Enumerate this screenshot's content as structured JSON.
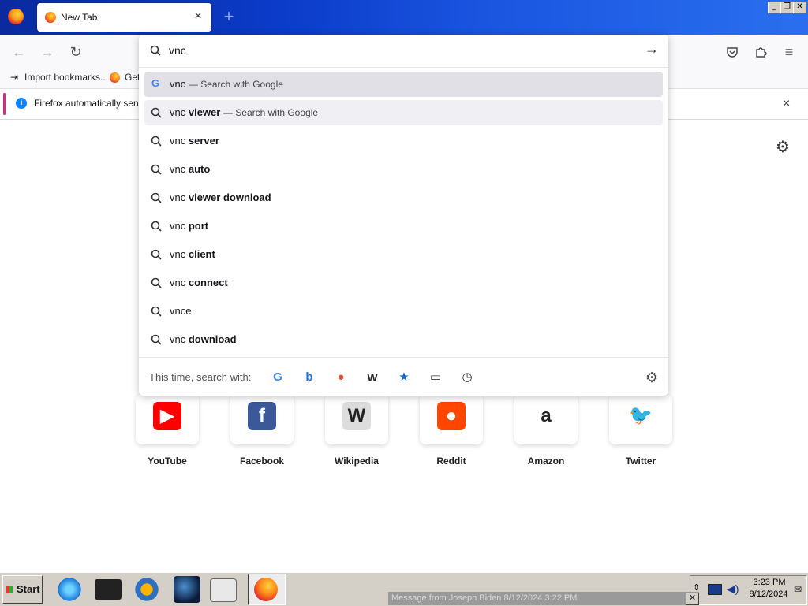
{
  "tab": {
    "title": "New Tab"
  },
  "urlbar": {
    "value": "vnc"
  },
  "bookmarks": [
    {
      "label": "Import bookmarks..."
    },
    {
      "label": "Get"
    }
  ],
  "notification": {
    "text": "Firefox automatically sends"
  },
  "suggestions": [
    {
      "prefix": "vnc",
      "bold": "",
      "suffix": "— Search with Google",
      "icon": "google-icon",
      "state": "selected"
    },
    {
      "prefix": "vnc",
      "bold": "viewer",
      "suffix": "— Search with Google",
      "icon": "search-icon",
      "state": "hover"
    },
    {
      "prefix": "vnc",
      "bold": "server",
      "suffix": "",
      "icon": "search-icon",
      "state": ""
    },
    {
      "prefix": "vnc",
      "bold": "auto",
      "suffix": "",
      "icon": "search-icon",
      "state": ""
    },
    {
      "prefix": "vnc",
      "bold": "viewer download",
      "suffix": "",
      "icon": "search-icon",
      "state": ""
    },
    {
      "prefix": "vnc",
      "bold": "port",
      "suffix": "",
      "icon": "search-icon",
      "state": ""
    },
    {
      "prefix": "vnc",
      "bold": "client",
      "suffix": "",
      "icon": "search-icon",
      "state": ""
    },
    {
      "prefix": "vnc",
      "bold": "connect",
      "suffix": "",
      "icon": "search-icon",
      "state": ""
    },
    {
      "prefix": "vnce",
      "bold": "",
      "suffix": "",
      "icon": "search-icon",
      "state": ""
    },
    {
      "prefix": "vnc",
      "bold": "download",
      "suffix": "",
      "icon": "search-icon",
      "state": ""
    }
  ],
  "oneoffs": {
    "label": "This time, search with:",
    "engines": [
      {
        "name": "google-icon",
        "glyph": "G",
        "color": "#4285f4"
      },
      {
        "name": "bing-icon",
        "glyph": "b",
        "color": "#1a73e8"
      },
      {
        "name": "duckduckgo-icon",
        "glyph": "●",
        "color": "#de5833"
      },
      {
        "name": "wikipedia-icon",
        "glyph": "W",
        "color": "#222222"
      },
      {
        "name": "bookmarks-star-icon",
        "glyph": "★",
        "color": "#0a64d6"
      },
      {
        "name": "tabs-icon",
        "glyph": "▭",
        "color": "#333333"
      },
      {
        "name": "history-clock-icon",
        "glyph": "◷",
        "color": "#333333"
      }
    ]
  },
  "topsites": [
    {
      "label": "YouTube",
      "glyph": "▶",
      "bg": "#ff0000"
    },
    {
      "label": "Facebook",
      "glyph": "f",
      "bg": "#3b5998"
    },
    {
      "label": "Wikipedia",
      "glyph": "W",
      "bg": "#dddddd"
    },
    {
      "label": "Reddit",
      "glyph": "●",
      "bg": "#ff4500"
    },
    {
      "label": "Amazon",
      "glyph": "a",
      "bg": "#ffffff"
    },
    {
      "label": "Twitter",
      "glyph": "🐦",
      "bg": "#ffffff"
    }
  ],
  "taskbar": {
    "start": "Start",
    "time": "3:23 PM",
    "date": "8/12/2024",
    "message": "Message from Joseph Biden 8/12/2024 3:22 PM"
  }
}
